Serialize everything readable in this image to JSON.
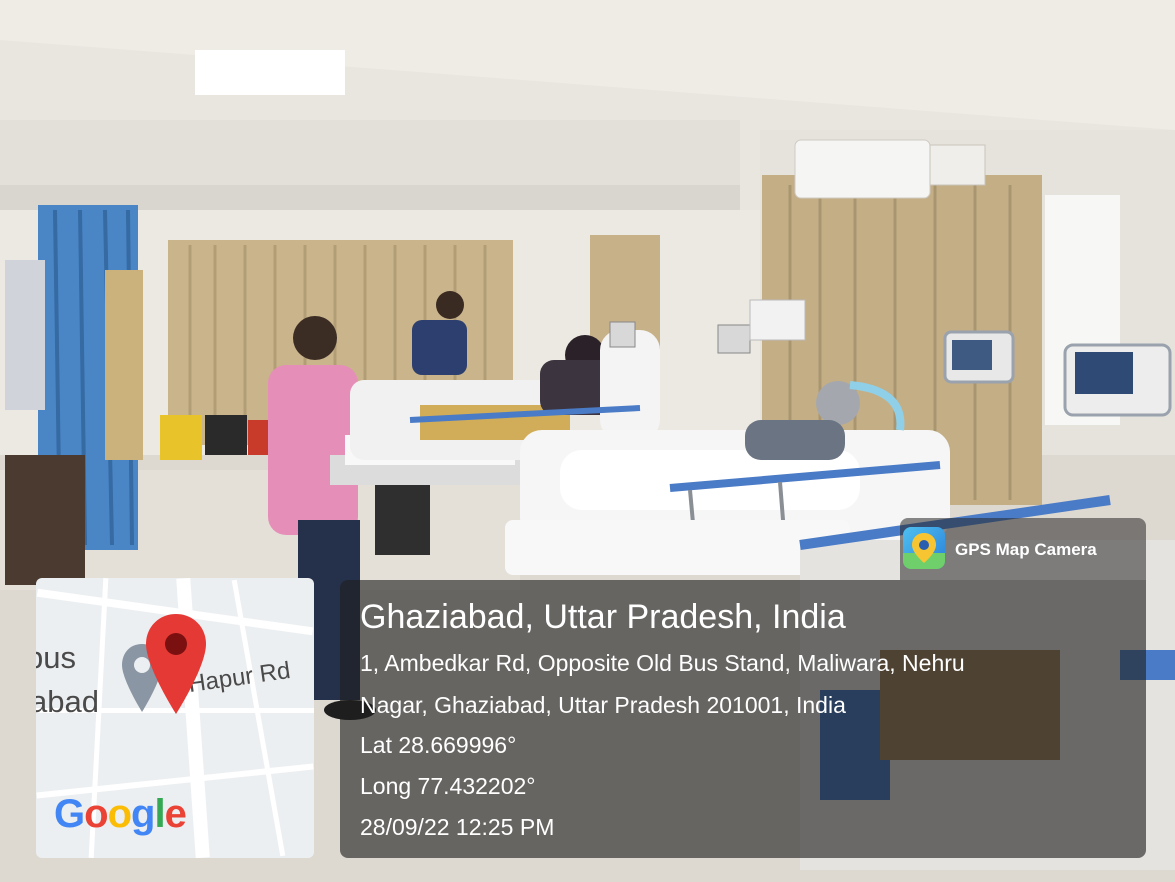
{
  "badge": {
    "app_name": "GPS Map Camera",
    "icon": "gps-map-camera-icon"
  },
  "location": {
    "city_line": "Ghaziabad, Uttar Pradesh, India",
    "address_line_1": "1, Ambedkar Rd, Opposite Old Bus Stand, Maliwara, Nehru",
    "address_line_2": "Nagar, Ghaziabad, Uttar Pradesh 201001, India",
    "lat": "Lat 28.669996°",
    "long": "Long 77.432202°",
    "datetime": "28/09/22 12:25 PM"
  },
  "map": {
    "label_bus": "bus",
    "label_abad": "abad",
    "label_road": "Hapur Rd",
    "provider": "Google",
    "pin_color": "#e53935",
    "provider_colors": [
      "#4285F4",
      "#EA4335",
      "#FBBC05",
      "#4285F4",
      "#34A853",
      "#EA4335"
    ]
  }
}
